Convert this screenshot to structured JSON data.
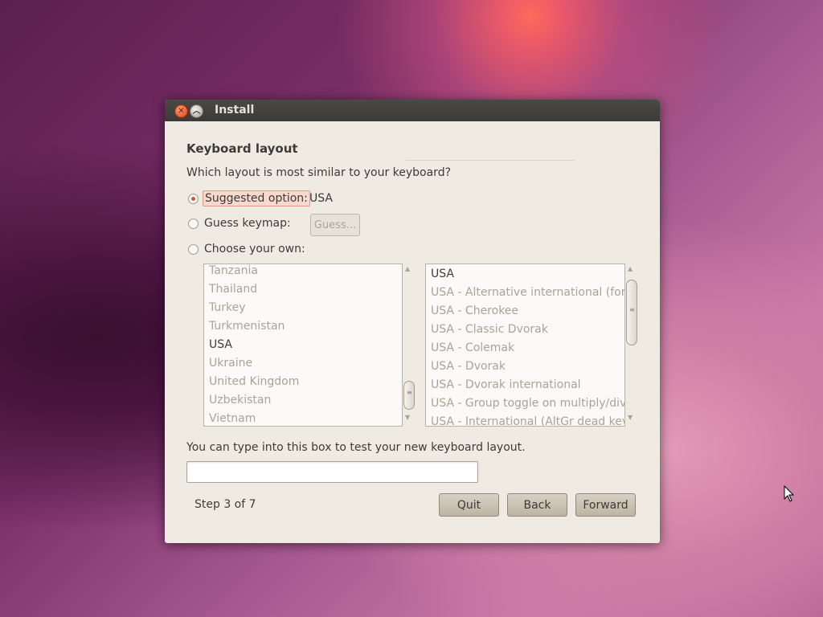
{
  "window": {
    "title": "Install"
  },
  "page": {
    "heading": "Keyboard layout",
    "question": "Which layout is most similar to your keyboard?"
  },
  "options": {
    "suggested": {
      "label": "Suggested option:",
      "value": "USA",
      "checked": true
    },
    "guess": {
      "label": "Guess keymap:",
      "button_label": "Guess...",
      "checked": false
    },
    "choose": {
      "label": "Choose your own:",
      "checked": false
    }
  },
  "countries": {
    "items": [
      "Tanzania",
      "Thailand",
      "Turkey",
      "Turkmenistan",
      "USA",
      "Ukraine",
      "United Kingdom",
      "Uzbekistan",
      "Vietnam"
    ],
    "selected": "USA"
  },
  "variants": {
    "items": [
      "USA",
      "USA - Alternative international (form",
      "USA - Cherokee",
      "USA - Classic Dvorak",
      "USA - Colemak",
      "USA - Dvorak",
      "USA - Dvorak international",
      "USA - Group toggle on multiply/divid",
      "USA - International (AltGr dead keys"
    ],
    "selected": "USA"
  },
  "test": {
    "label": "You can type into this box to test your new keyboard layout.",
    "value": ""
  },
  "footer": {
    "step": "Step 3 of 7",
    "quit_label": "Quit",
    "back_label": "Back",
    "forward_label": "Forward"
  },
  "colors": {
    "accent": "#d2583c",
    "window_bg": "#f0ebe2",
    "titlebar": "#3c3b37"
  }
}
